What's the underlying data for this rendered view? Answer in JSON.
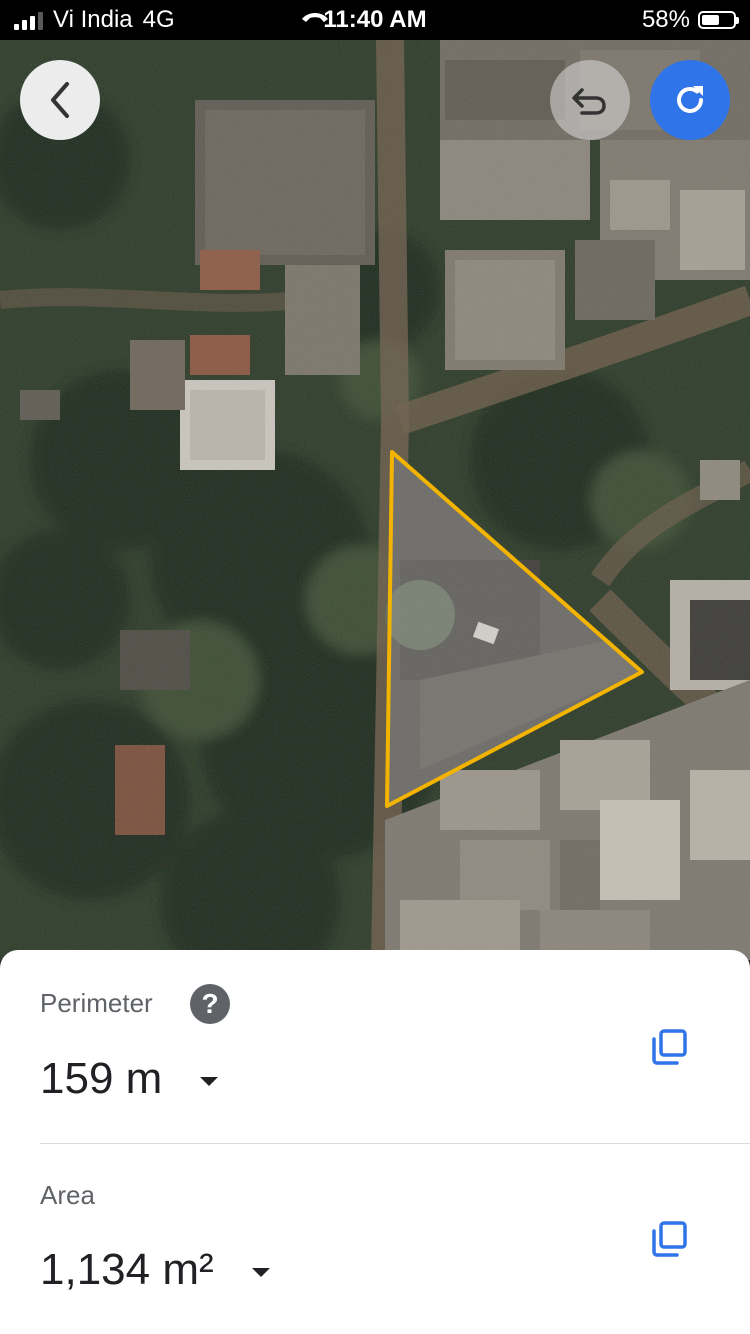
{
  "status_bar": {
    "carrier": "Vi India",
    "network": "4G",
    "time": "11:40 AM",
    "battery": "58%",
    "battery_level": 0.58
  },
  "toolbar": {
    "back_icon": "chevron-left-icon",
    "undo_icon": "undo-icon",
    "redo_icon": "redo-icon"
  },
  "map": {
    "type": "satellite",
    "shape_color": "#f2b400"
  },
  "measurements": {
    "perimeter_label": "Perimeter",
    "perimeter_value": "159 m",
    "area_label": "Area",
    "area_value": "1,134 m²"
  },
  "colors": {
    "accent": "#2f74e8",
    "outline": "#f2b400"
  }
}
